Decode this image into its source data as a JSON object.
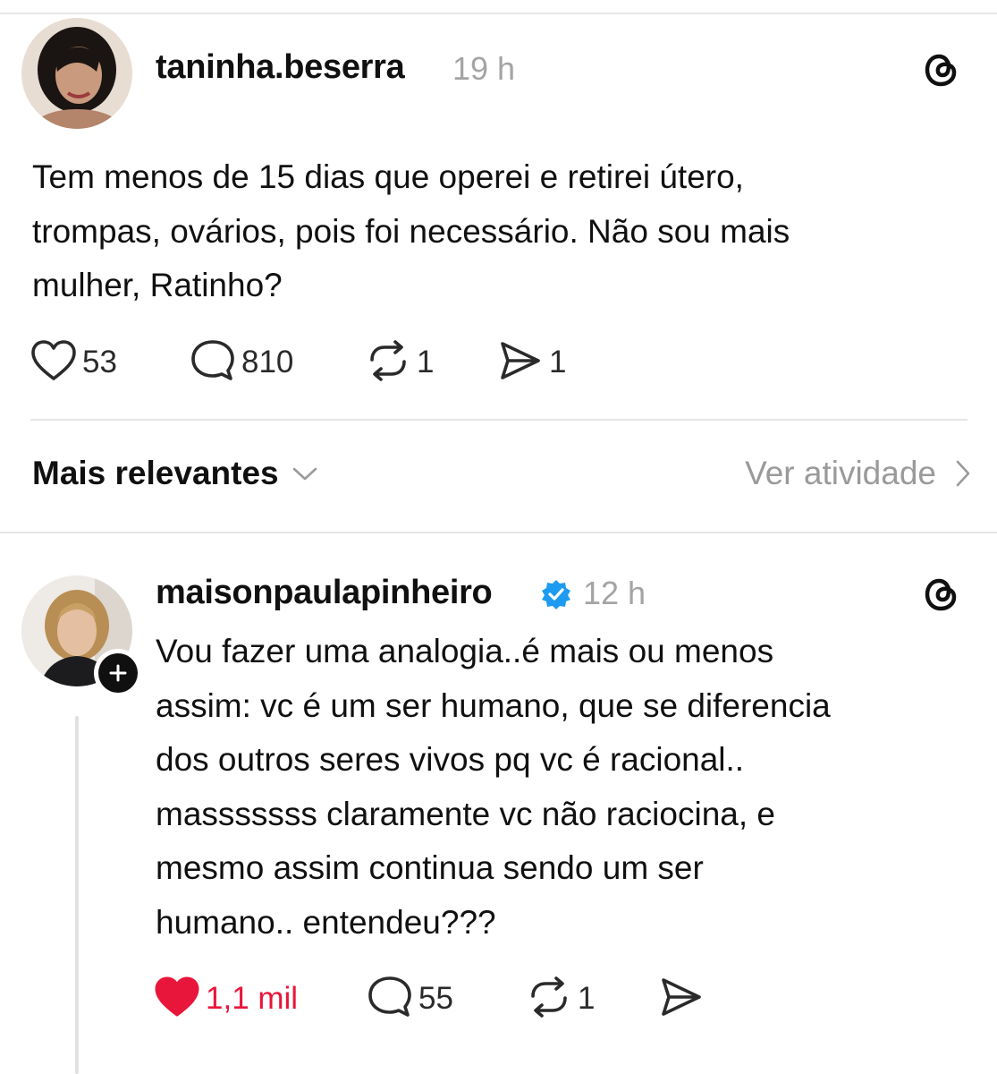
{
  "post": {
    "username": "taninha.beserra",
    "time": "19 h",
    "text": "Tem menos de 15 dias que operei e retirei útero,\ntrompas, ovários,  pois foi necessário.  Não sou mais\nmulher, Ratinho?",
    "actions": {
      "likes": "53",
      "comments": "810",
      "reposts": "1",
      "shares": "1"
    }
  },
  "sort": {
    "label": "Mais relevantes",
    "activity_label": "Ver atividade"
  },
  "reply": {
    "username": "maisonpaulapinheiro",
    "verified": true,
    "time": "12 h",
    "text": "Vou fazer uma analogia..é mais ou menos\nassim: vc é um ser humano, que se diferencia\ndos outros seres vivos pq vc é racional..\nmasssssss claramente vc não raciocina, e\nmesmo assim continua sendo um ser\nhumano.. entendeu???",
    "actions": {
      "likes": "1,1 mil",
      "liked": true,
      "comments": "55",
      "reposts": "1"
    }
  },
  "colors": {
    "like_active": "#e8163a",
    "verified_badge": "#1d9bf0",
    "muted_text": "#a4a4a4"
  },
  "icons": [
    "heart-icon",
    "comment-icon",
    "repost-icon",
    "share-icon",
    "threads-logo-icon",
    "chevron-down-icon",
    "chevron-right-icon",
    "verified-badge-icon",
    "follow-plus-icon"
  ]
}
